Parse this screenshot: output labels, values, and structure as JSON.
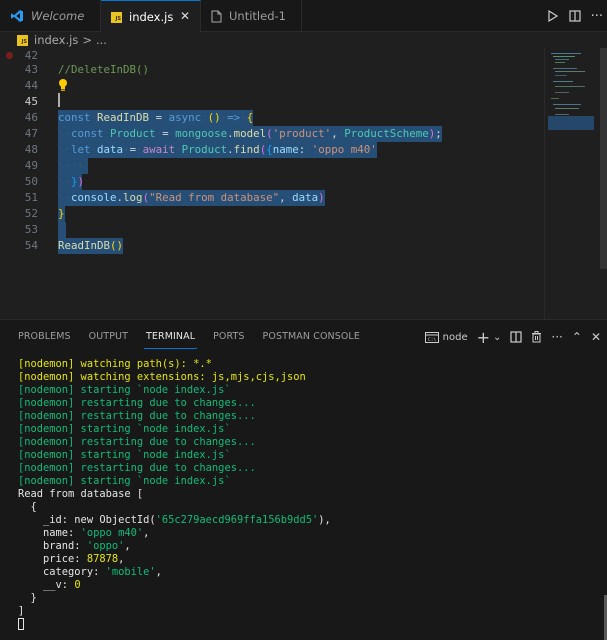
{
  "tabs": [
    {
      "label": "Welcome",
      "icon": "vscode-logo-icon"
    },
    {
      "label": "index.js",
      "icon": "js-file-icon",
      "active": true,
      "close": "✕"
    },
    {
      "label": "Untitled-1",
      "icon": "file-icon"
    }
  ],
  "tab_actions": {
    "run": "run-icon",
    "split": "split-editor-icon",
    "more": "···"
  },
  "breadcrumb": {
    "file": "index.js",
    "separator": ">",
    "more": "..."
  },
  "js_badge": "JS",
  "editor": {
    "line_numbers": [
      "42",
      "43",
      "44",
      "45",
      "46",
      "47",
      "48",
      "49",
      "50",
      "51",
      "52",
      "53",
      "54"
    ],
    "current_line": "45",
    "lines": {
      "l43": "//DeleteInDB()",
      "l46": [
        "const",
        " ",
        "ReadInDB",
        " = ",
        "async",
        " ",
        "()",
        " => ",
        "{"
      ],
      "l47": [
        "  ",
        "const",
        " ",
        "Product",
        " = ",
        "mongoose",
        ".",
        "model",
        "(",
        "'product'",
        ", ",
        "ProductScheme",
        ")",
        ";"
      ],
      "l48": [
        "  ",
        "let",
        " ",
        "data",
        " = ",
        "await",
        " ",
        "Product",
        ".",
        "find",
        "(",
        "{",
        "name",
        ": ",
        "'oppo m40'"
      ],
      "l49": "    ",
      "l50": [
        "  ",
        "}",
        ")"
      ],
      "l51": [
        "  ",
        "console",
        ".",
        "log",
        "(",
        "\"Read from database\"",
        ", ",
        "data",
        ")"
      ],
      "l52": "}",
      "l54": [
        "ReadInDB",
        "()"
      ]
    }
  },
  "panel": {
    "tabs": [
      "PROBLEMS",
      "OUTPUT",
      "TERMINAL",
      "PORTS",
      "POSTMAN CONSOLE"
    ],
    "active_tab": "TERMINAL",
    "terminal_name": "node",
    "actions": [
      "+",
      "⌄",
      "split-terminal-icon",
      "trash-icon",
      "···",
      "⌃",
      "✕"
    ]
  },
  "terminal": {
    "lines": [
      {
        "text": "[nodemon] watching path(s): *.*",
        "color": "yellow"
      },
      {
        "text": "[nodemon] watching extensions: js,mjs,cjs,json",
        "color": "yellow"
      },
      {
        "text": "[nodemon] starting `node index.js`",
        "color": "green"
      },
      {
        "text": "[nodemon] restarting due to changes...",
        "color": "green"
      },
      {
        "text": "[nodemon] restarting due to changes...",
        "color": "green"
      },
      {
        "text": "[nodemon] starting `node index.js`",
        "color": "green"
      },
      {
        "text": "[nodemon] restarting due to changes...",
        "color": "green"
      },
      {
        "text": "[nodemon] starting `node index.js`",
        "color": "green"
      },
      {
        "text": "[nodemon] restarting due to changes...",
        "color": "green"
      },
      {
        "text": "[nodemon] starting `node index.js`",
        "color": "green"
      },
      {
        "text": "Read from database [",
        "color": "white"
      }
    ],
    "record": {
      "open": "  {",
      "id_key": "    _id: new ObjectId(",
      "id_val": "'65c279aecd969ffa156b9dd5'",
      "id_end": "),",
      "name_key": "    name: ",
      "name_val": "'oppo m40'",
      "brand_key": "    brand: ",
      "brand_val": "'oppo'",
      "price_key": "    price: ",
      "price_val": "87878",
      "category_key": "    category: ",
      "category_val": "'mobile'",
      "v_key": "    __v: ",
      "v_val": "0",
      "close": "  }",
      "arr_close": "]"
    }
  },
  "colors": {
    "accent": "#0078d4",
    "selection": "#264f78",
    "term_yellow": "#e5e510",
    "term_green": "#0dbc79"
  }
}
